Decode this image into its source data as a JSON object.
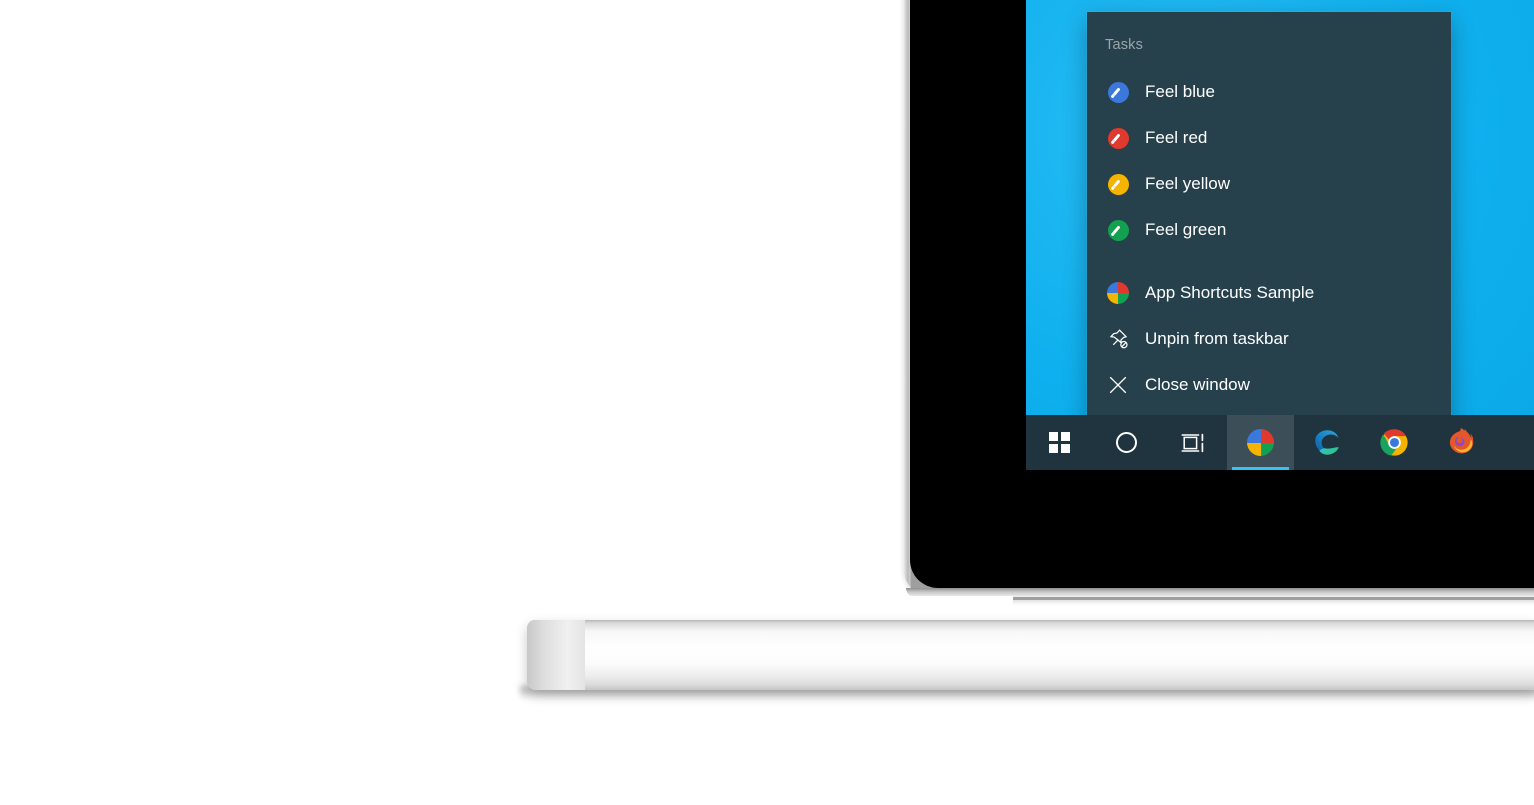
{
  "scene": {
    "device": "laptop",
    "desktop_color": "#12b3f0",
    "bezel_color": "#000000",
    "base_color": "#ffffff"
  },
  "jumplist": {
    "background_color": "#26404c",
    "tasks_header": "Tasks",
    "tasks": [
      {
        "label": "Feel blue",
        "icon": "brush-circle-icon",
        "color": "#3b78dc"
      },
      {
        "label": "Feel red",
        "icon": "brush-circle-icon",
        "color": "#e03a2f"
      },
      {
        "label": "Feel yellow",
        "icon": "brush-circle-icon",
        "color": "#f4b400"
      },
      {
        "label": "Feel green",
        "icon": "brush-circle-icon",
        "color": "#12a150"
      }
    ],
    "app_actions": [
      {
        "label": "App Shortcuts Sample",
        "icon": "app-pie-icon"
      },
      {
        "label": "Unpin from taskbar",
        "icon": "unpin-icon"
      },
      {
        "label": "Close window",
        "icon": "close-x-icon"
      }
    ]
  },
  "taskbar": {
    "background_color": "#1f343f",
    "active_indicator_color": "#35c3f5",
    "buttons": [
      {
        "name": "start-button",
        "icon": "windows-logo-icon",
        "active": false
      },
      {
        "name": "cortana-button",
        "icon": "cortana-circle-icon",
        "active": false
      },
      {
        "name": "task-view-button",
        "icon": "task-view-icon",
        "active": false
      },
      {
        "name": "app-shortcuts-sample-button",
        "icon": "app-pie-icon",
        "active": true
      },
      {
        "name": "edge-button",
        "icon": "edge-icon",
        "active": false
      },
      {
        "name": "chrome-button",
        "icon": "chrome-icon",
        "active": false
      },
      {
        "name": "firefox-button",
        "icon": "firefox-icon",
        "active": false
      }
    ]
  },
  "app_icon_colors": {
    "top_left": "#3b78dc",
    "top_right": "#e03a2f",
    "bottom_left": "#f4b400",
    "bottom_right": "#12a150"
  }
}
